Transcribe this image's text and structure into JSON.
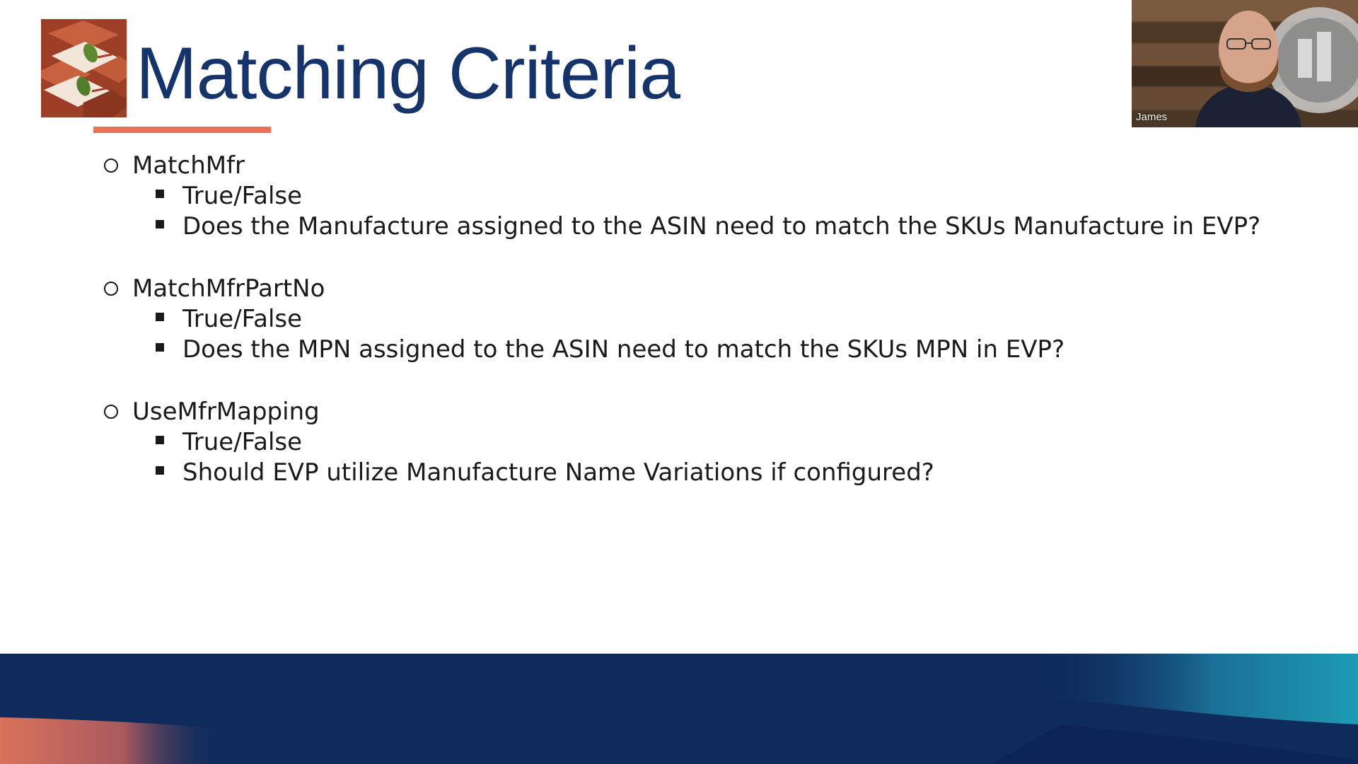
{
  "slide": {
    "title": "Matching Criteria",
    "sections": [
      {
        "label": "MatchMfr",
        "items": [
          "True/False",
          "Does the Manufacture assigned to the ASIN need to match the SKUs Manufacture in EVP?"
        ]
      },
      {
        "label": "MatchMfrPartNo",
        "items": [
          "True/False",
          "Does the MPN assigned to the ASIN need to match the SKUs MPN in EVP?"
        ]
      },
      {
        "label": "UseMfrMapping",
        "items": [
          "True/False",
          "Should EVP utilize Manufacture Name Variations if configured?"
        ]
      }
    ]
  },
  "webcam": {
    "participant_name": "James"
  },
  "colors": {
    "title": "#14346b",
    "accent": "#e8735a",
    "band": "#0e2b5c",
    "band_teal": "#1a8aa8"
  }
}
